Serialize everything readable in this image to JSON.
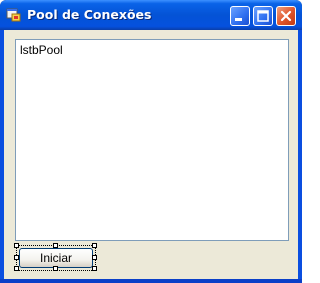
{
  "window": {
    "title": "Pool de Conexões",
    "controls": {
      "minimize": "minimize-icon",
      "maximize": "maximize-icon",
      "close": "close-icon"
    }
  },
  "form": {
    "listbox": {
      "name": "lstbPool"
    },
    "start_button": {
      "label": "Iniciar",
      "selected": true
    }
  },
  "colors": {
    "titlebar": "#0453d6",
    "client": "#ece9d8",
    "close_button": "#e0542a",
    "listbox_border": "#7f9db9"
  }
}
